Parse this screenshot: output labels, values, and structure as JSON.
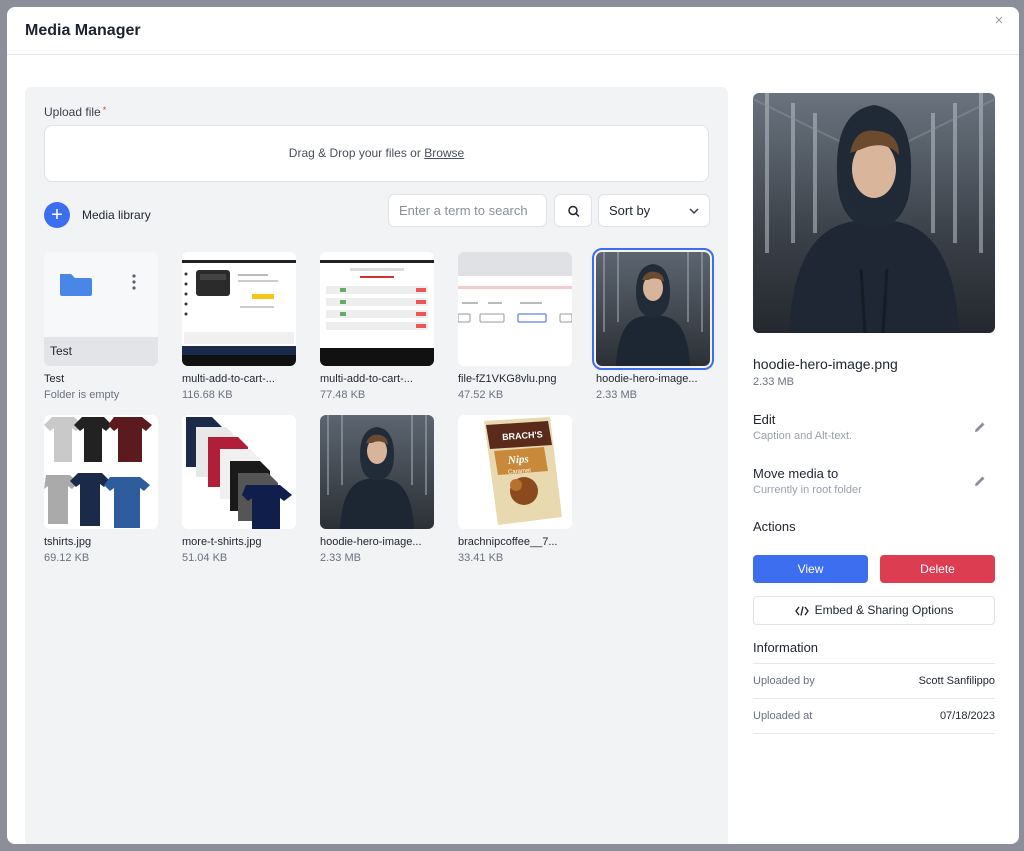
{
  "modal": {
    "title": "Media Manager",
    "close_glyph": "×"
  },
  "upload": {
    "label": "Upload file",
    "required_mark": "*",
    "drop_text": "Drag & Drop your files or ",
    "browse_text": "Browse"
  },
  "library": {
    "button_glyph": "+",
    "label": "Media library",
    "search_placeholder": "Enter a term to search",
    "sort_label": "Sort by"
  },
  "items": [
    {
      "name": "Test",
      "meta": "Folder is empty",
      "kind": "folder",
      "folder_label": "Test"
    },
    {
      "name": "multi-add-to-cart-...",
      "meta": "116.68 KB",
      "kind": "screenshot"
    },
    {
      "name": "multi-add-to-cart-...",
      "meta": "77.48 KB",
      "kind": "screenshot"
    },
    {
      "name": "file-fZ1VKG8vlu.png",
      "meta": "47.52 KB",
      "kind": "screenshot"
    },
    {
      "name": "hoodie-hero-image...",
      "meta": "2.33 MB",
      "kind": "photo",
      "selected": true
    },
    {
      "name": "tshirts.jpg",
      "meta": "69.12 KB",
      "kind": "photo"
    },
    {
      "name": "more-t-shirts.jpg",
      "meta": "51.04 KB",
      "kind": "photo"
    },
    {
      "name": "hoodie-hero-image...",
      "meta": "2.33 MB",
      "kind": "photo"
    },
    {
      "name": "brachnipcoffee__7...",
      "meta": "33.41 KB",
      "kind": "photo"
    }
  ],
  "details": {
    "filename": "hoodie-hero-image.png",
    "filesize": "2.33 MB",
    "edit_title": "Edit",
    "edit_sub": "Caption and Alt-text.",
    "move_title": "Move media to",
    "move_sub": "Currently in root folder",
    "actions_title": "Actions",
    "view_label": "View",
    "delete_label": "Delete",
    "embed_label": "Embed & Sharing Options",
    "info_title": "Information",
    "uploaded_by_label": "Uploaded by",
    "uploaded_by_value": "Scott Sanfilippo",
    "uploaded_at_label": "Uploaded at",
    "uploaded_at_value": "07/18/2023"
  },
  "thumb_text": {
    "brand_top": "BRACH'S",
    "brand_name": "Nips",
    "brand_flavor": "Caramel"
  },
  "colors": {
    "accent": "#3e6ef0",
    "danger": "#dd3d51",
    "panel_bg": "#f2f3f5"
  }
}
